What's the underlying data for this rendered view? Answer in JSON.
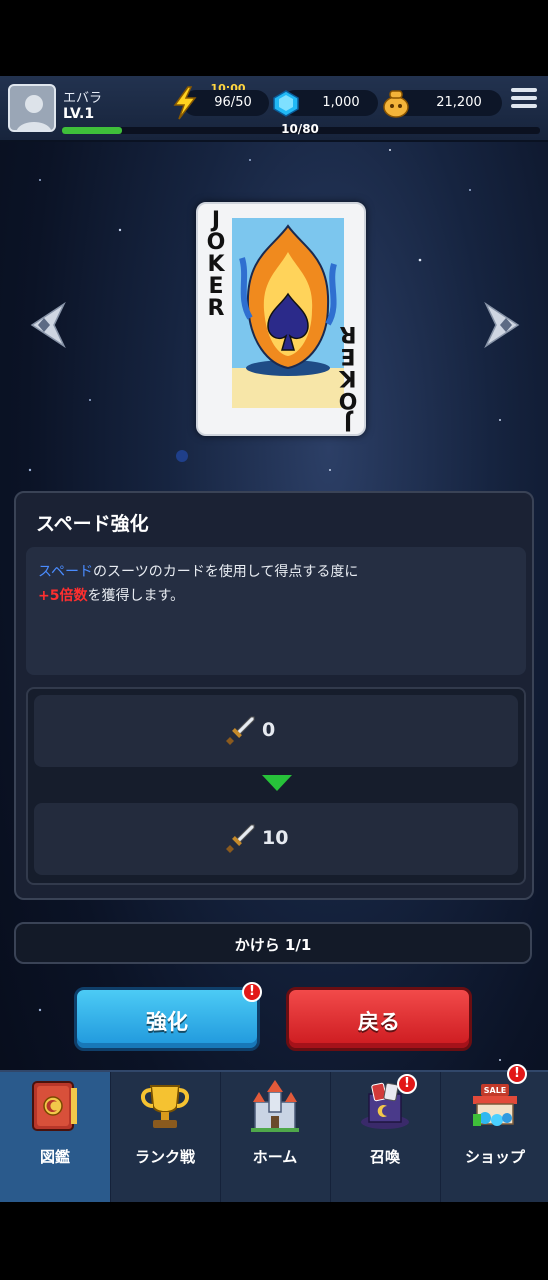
{
  "header": {
    "player_name": "エバラ",
    "player_level": "LV.1",
    "xp_progress": 0.125,
    "xp_text": "10/80",
    "energy_timer": "10:00",
    "energy": "96/50",
    "gems": "1,000",
    "coins": "21,200"
  },
  "card": {
    "label": "JOKER",
    "suit": "spade"
  },
  "panel": {
    "title": "スペード強化",
    "desc_suit": "スペード",
    "desc_line1_rest": "のスーツのカードを使用して得点する度に",
    "desc_bonus": "+5倍数",
    "desc_line2_rest": "を獲得します。",
    "stat_current": "0",
    "stat_next": "10"
  },
  "limit_text": "かけら 1/1",
  "buttons": {
    "upgrade": "強化",
    "back": "戻る",
    "alert_mark": "!"
  },
  "nav": [
    {
      "label": "図鑑",
      "active": true
    },
    {
      "label": "ランク戦"
    },
    {
      "label": "ホーム"
    },
    {
      "label": "召喚"
    },
    {
      "label": "ショップ",
      "tag": "SALE"
    }
  ],
  "colors": {
    "accent_blue": "#1f97dc",
    "accent_red": "#cc1a1f",
    "xp_green": "#3fbf3a",
    "energy_yellow": "#ffd640"
  }
}
